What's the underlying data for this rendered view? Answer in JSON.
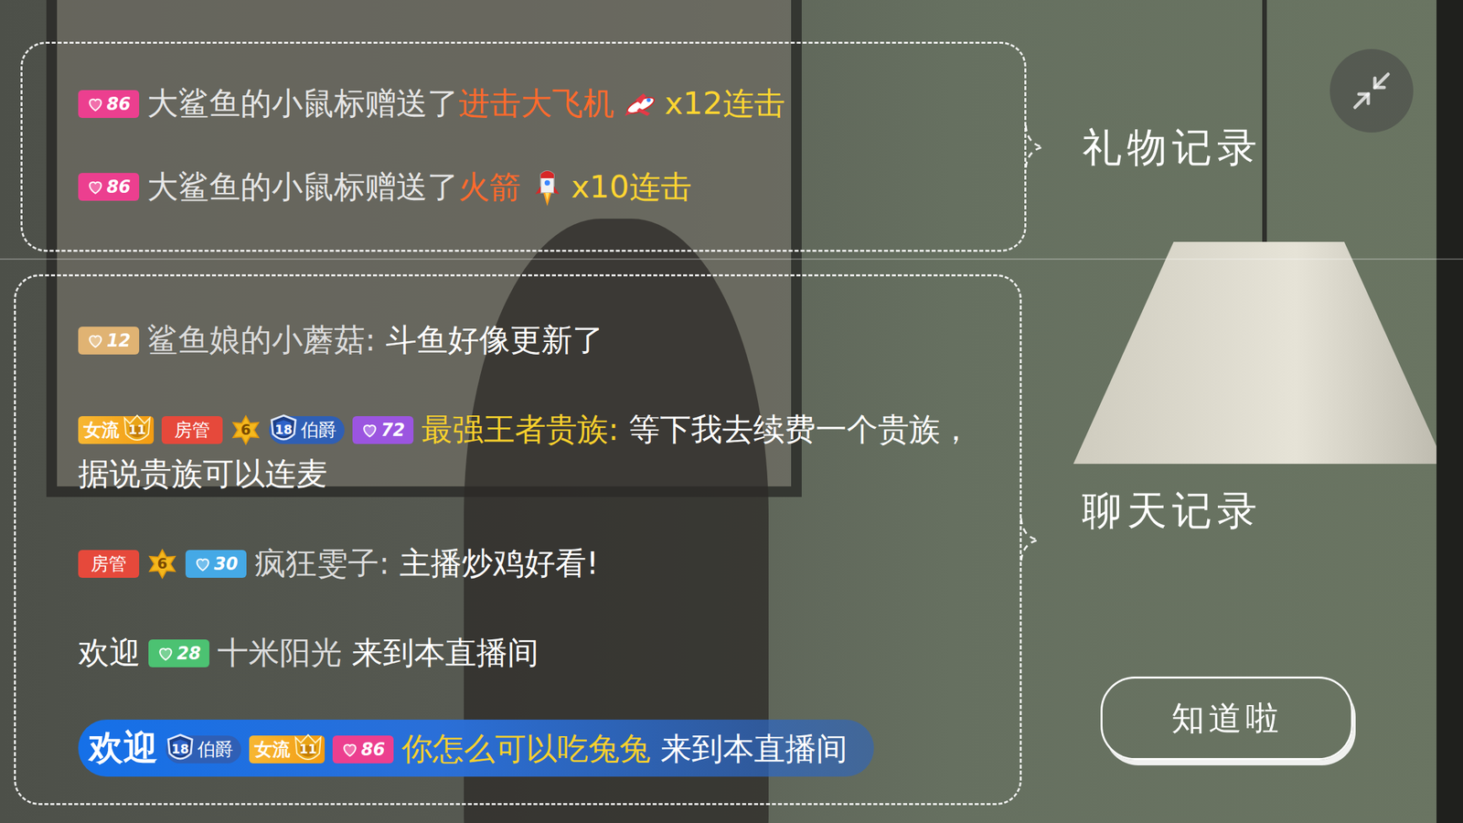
{
  "gifts": [
    {
      "badges": [
        {
          "kind": "level",
          "text": "86",
          "color": "#ec3f8f"
        }
      ],
      "user": "大鲨鱼的小鼠标",
      "verb": "赠送了",
      "gift": "进击大飞机",
      "kind": "plane",
      "combo": "x12连击"
    },
    {
      "badges": [
        {
          "kind": "level",
          "text": "86",
          "color": "#ec3f8f"
        }
      ],
      "user": "大鲨鱼的小鼠标",
      "verb": "赠送了",
      "gift": "火箭",
      "kind": "rocket",
      "combo": "x10连击"
    }
  ],
  "chat": [
    {
      "kind": "message",
      "badges": [
        {
          "kind": "level",
          "text": "12",
          "color": "#e0b373"
        }
      ],
      "user": "鲨鱼娘的小蘑菇:",
      "user_color": "#dcdcdc",
      "text": "斗鱼好像更新了"
    },
    {
      "kind": "message",
      "badges": [
        {
          "kind": "fan",
          "text": "女流",
          "num": "11"
        },
        {
          "kind": "admin",
          "text": "房管"
        },
        {
          "kind": "star",
          "text": "6"
        },
        {
          "kind": "noble",
          "num": "18",
          "text": "伯爵"
        },
        {
          "kind": "level",
          "text": "72",
          "color": "#9b55e0"
        }
      ],
      "user": "最强王者贵族:",
      "user_color": "#f7d02c",
      "text": "等下我去续费一个贵族，据说贵族可以连麦"
    },
    {
      "kind": "message",
      "badges": [
        {
          "kind": "admin",
          "text": "房管"
        },
        {
          "kind": "star",
          "text": "6"
        },
        {
          "kind": "level",
          "text": "30",
          "color": "#45a9e6"
        }
      ],
      "user": "疯狂雯子:",
      "user_color": "#dcdcdc",
      "text": "主播炒鸡好看!"
    },
    {
      "kind": "welcome",
      "prefix": "欢迎",
      "badges": [
        {
          "kind": "level",
          "text": "28",
          "color": "#4cc272"
        }
      ],
      "user": "十米阳光",
      "user_color": "#dcdcdc",
      "suffix": "来到本直播间"
    },
    {
      "kind": "noble-welcome",
      "prefix": "欢迎",
      "badges": [
        {
          "kind": "noble",
          "num": "18",
          "text": "伯爵"
        },
        {
          "kind": "fan",
          "text": "女流",
          "num": "11"
        },
        {
          "kind": "level",
          "text": "86",
          "color": "#ec3f8f"
        }
      ],
      "user": "你怎么可以吃兔兔",
      "user_color": "#f7d02c",
      "suffix": "来到本直播间"
    }
  ],
  "labels": {
    "gifts": "礼物记录",
    "chat": "聊天记录"
  },
  "button": "知道啦"
}
